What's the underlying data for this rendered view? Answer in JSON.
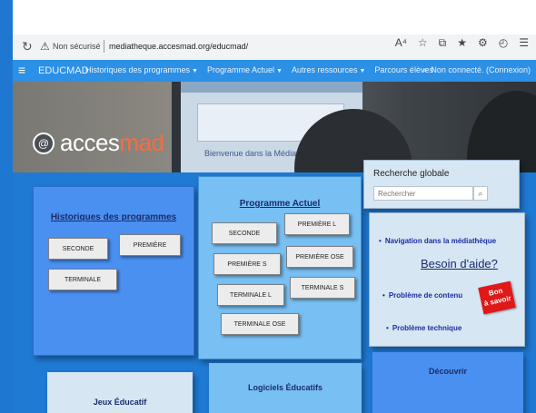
{
  "browser": {
    "security_label": "Non sécurisé",
    "url": "mediatheque.accesmad.org/educmad/",
    "reload_icon": "reload-icon",
    "warning_icon": "warning-icon"
  },
  "nav": {
    "brand": "EDUCMAD",
    "links": [
      {
        "label": "Historiques des programmes"
      },
      {
        "label": "Programme Actuel"
      },
      {
        "label": "Autres ressources"
      },
      {
        "label": "Parcours élèves"
      }
    ],
    "right": "Non connecté. (Connexion)"
  },
  "banner": {
    "screen_welcome": "Bienvenue dans la Médiathèque",
    "logo_prefix": "acces",
    "logo_suffix": "mad"
  },
  "historiques": {
    "title": "Historiques des programmes",
    "buttons": [
      "SECONDE",
      "PREMIÈRE",
      "TERMINALE"
    ]
  },
  "programme": {
    "title": "Programme Actuel",
    "buttons": [
      "SECONDE",
      "PREMIÈRE L",
      "PREMIÈRE S",
      "PREMIÈRE OSE",
      "TERMINALE L",
      "TERMINALE S",
      "TERMINALE OSE"
    ]
  },
  "search": {
    "title": "Recherche globale",
    "placeholder": "Rechercher"
  },
  "help": {
    "navigation_link": "Navigation dans la médiathèque",
    "title": "Besoin d'aide?",
    "contenu_link": "Problème de contenu",
    "technique_link": "Problème technique",
    "badge_line1": "Bon",
    "badge_line2": "à savoir"
  },
  "bottom": {
    "card1_title": "Jeux Éducatif",
    "card2_title": "Logiciels Éducatifs",
    "card3_title": "Découvrir"
  },
  "colors": {
    "body_blue": "#1f7ad4",
    "nav_blue": "#2b90e6",
    "badge_red": "#e01818"
  }
}
